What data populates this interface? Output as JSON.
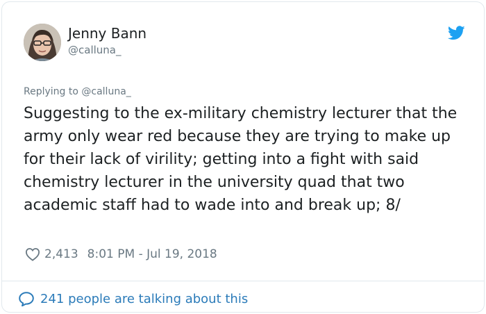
{
  "author": {
    "display_name": "Jenny Bann",
    "handle": "@calluna_"
  },
  "reply_prefix": "Replying to",
  "reply_to": "@calluna_",
  "tweet_text": "Suggesting to the ex-military chemistry lecturer that the army only wear red because they are trying to make up for their lack of virility; getting into a fight with said chemistry lecturer in the university quad that two academic staff had to wade into and break up; 8/",
  "meta": {
    "like_count": "2,413",
    "timestamp": "8:01 PM - Jul 19, 2018"
  },
  "footer": {
    "talking_text": "241 people are talking about this"
  },
  "icons": {
    "brand": "twitter-bird-icon",
    "like": "heart-icon",
    "conversation": "speech-bubble-icon"
  },
  "colors": {
    "brand_blue": "#1da1f2",
    "link_blue": "#2b7bb9",
    "secondary_text": "#697882",
    "border": "#e1e8ed"
  }
}
